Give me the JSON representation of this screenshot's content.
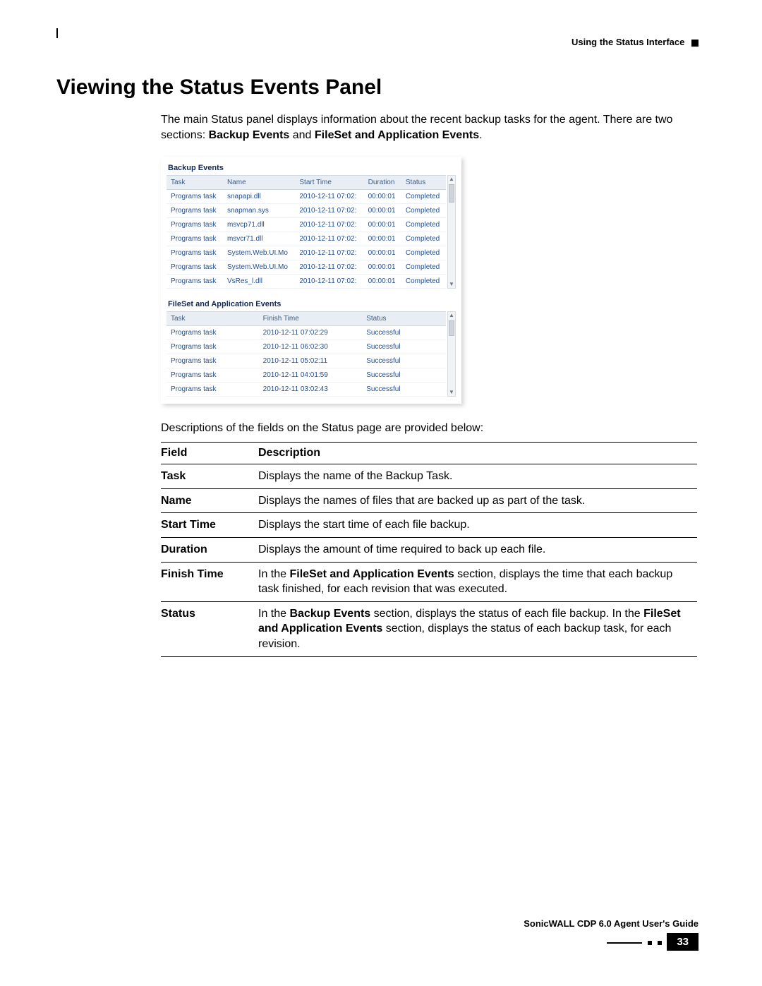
{
  "header": {
    "breadcrumb": "Using the Status Interface"
  },
  "title": "Viewing the Status Events Panel",
  "intro": {
    "pre": "The main Status panel displays information about the recent backup tasks for the agent. There are two sections: ",
    "b1": "Backup Events",
    "mid": " and ",
    "b2": "FileSet and Application Events",
    "post": "."
  },
  "screenshot": {
    "backup_events": {
      "title": "Backup Events",
      "headers": [
        "Task",
        "Name",
        "Start Time",
        "Duration",
        "Status"
      ],
      "rows": [
        [
          "Programs task",
          "snapapi.dll",
          "2010-12-11 07:02:",
          "00:00:01",
          "Completed"
        ],
        [
          "Programs task",
          "snapman.sys",
          "2010-12-11 07:02:",
          "00:00:01",
          "Completed"
        ],
        [
          "Programs task",
          "msvcp71.dll",
          "2010-12-11 07:02:",
          "00:00:01",
          "Completed"
        ],
        [
          "Programs task",
          "msvcr71.dll",
          "2010-12-11 07:02:",
          "00:00:01",
          "Completed"
        ],
        [
          "Programs task",
          "System.Web.UI.Mo",
          "2010-12-11 07:02:",
          "00:00:01",
          "Completed"
        ],
        [
          "Programs task",
          "System.Web.UI.Mo",
          "2010-12-11 07:02:",
          "00:00:01",
          "Completed"
        ],
        [
          "Programs task",
          "VsRes_l.dll",
          "2010-12-11 07:02:",
          "00:00:01",
          "Completed"
        ]
      ]
    },
    "fileset_events": {
      "title": "FileSet and Application Events",
      "headers": [
        "Task",
        "Finish Time",
        "Status"
      ],
      "rows": [
        [
          "Programs task",
          "2010-12-11 07:02:29",
          "Successful"
        ],
        [
          "Programs task",
          "2010-12-11 06:02:30",
          "Successful"
        ],
        [
          "Programs task",
          "2010-12-11 05:02:11",
          "Successful"
        ],
        [
          "Programs task",
          "2010-12-11 04:01:59",
          "Successful"
        ],
        [
          "Programs task",
          "2010-12-11 03:02:43",
          "Successful"
        ]
      ]
    }
  },
  "post_shot": "Descriptions of the fields on the Status page are provided below:",
  "field_table": {
    "head_field": "Field",
    "head_desc": "Description",
    "rows": [
      {
        "field": "Task",
        "desc_html": "Displays the name of the Backup Task."
      },
      {
        "field": "Name",
        "desc_html": "Displays the names of files that are backed up as part of the task."
      },
      {
        "field": "Start Time",
        "desc_html": "Displays the start time of each file backup."
      },
      {
        "field": "Duration",
        "desc_html": "Displays the amount of time required to back up each file."
      },
      {
        "field": "Finish Time",
        "desc_html": "In the <b>FileSet and Application Events</b> section, displays the time that each backup task finished, for each revision that was executed."
      },
      {
        "field": "Status",
        "desc_html": "In the <b>Backup Events</b> section, displays the status of each file backup. In the <b>FileSet and Application Events</b> section, displays the status of each backup task, for each revision."
      }
    ]
  },
  "footer": {
    "guide": "SonicWALL CDP 6.0 Agent User's Guide",
    "page": "33"
  }
}
